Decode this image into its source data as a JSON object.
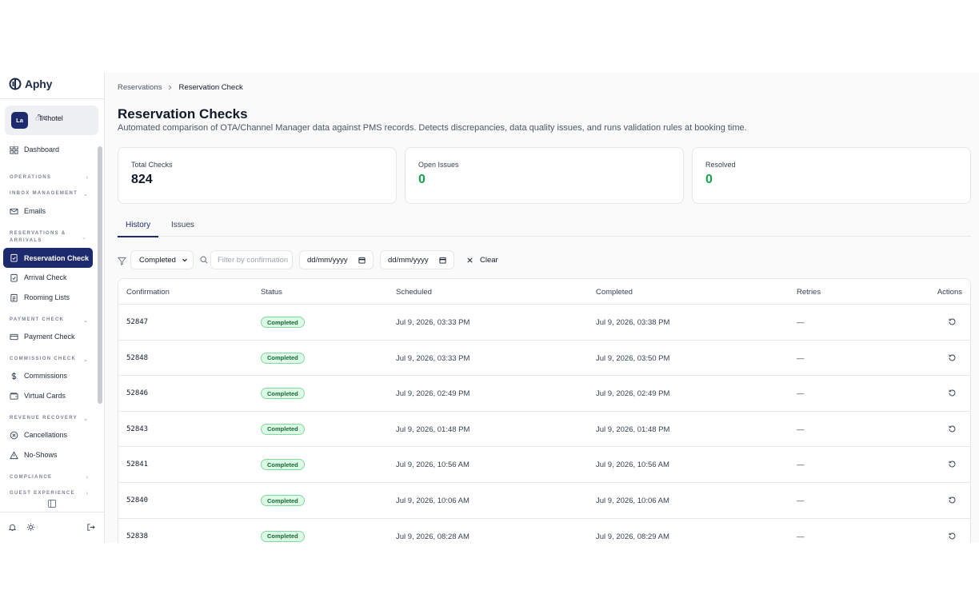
{
  "app": {
    "name": "Aphy"
  },
  "hotel": {
    "initials": "La",
    "name": "ीlधhotel"
  },
  "sidebar": {
    "dashboard": "Dashboard",
    "sections": {
      "operations": "OPERATIONS",
      "inbox": "INBOX MANAGEMENT",
      "reservations_line1": "RESERVATIONS &",
      "reservations_line2": "ARRIVALS",
      "payment": "PAYMENT CHECK",
      "commission": "COMMISSION CHECK",
      "revenue": "REVENUE RECOVERY",
      "compliance": "COMPLIANCE",
      "guest": "GUEST EXPERIENCE"
    },
    "items": {
      "emails": "Emails",
      "reservation_check": "Reservation Check",
      "arrival_check": "Arrival Check",
      "rooming_lists": "Rooming Lists",
      "payment_check": "Payment Check",
      "commissions": "Commissions",
      "virtual_cards": "Virtual Cards",
      "cancellations": "Cancellations",
      "no_shows": "No-Shows"
    }
  },
  "breadcrumb": {
    "parent": "Reservations",
    "current": "Reservation Check"
  },
  "page": {
    "title": "Reservation Checks",
    "subtitle": "Automated comparison of OTA/Channel Manager data against PMS records. Detects discrepancies, data quality issues, and runs validation rules at booking time."
  },
  "stats": {
    "total": {
      "label": "Total Checks",
      "value": "824"
    },
    "open": {
      "label": "Open Issues",
      "value": "0"
    },
    "resolved": {
      "label": "Resolved",
      "value": "0"
    }
  },
  "tabs": {
    "history": "History",
    "issues": "Issues"
  },
  "filters": {
    "status": "Completed",
    "search_placeholder": "Filter by confirmation",
    "date_from": "dd/mm/yyyy",
    "date_to": "dd/mm/yyyy",
    "clear": "Clear"
  },
  "table": {
    "headers": {
      "confirmation": "Confirmation",
      "status": "Status",
      "scheduled": "Scheduled",
      "completed": "Completed",
      "retries": "Retries",
      "actions": "Actions"
    },
    "rows": [
      {
        "conf": "52847",
        "status": "Completed",
        "scheduled": "Jul 9, 2026, 03:33 PM",
        "completed": "Jul 9, 2026, 03:38 PM",
        "retries": "—"
      },
      {
        "conf": "52848",
        "status": "Completed",
        "scheduled": "Jul 9, 2026, 03:33 PM",
        "completed": "Jul 9, 2026, 03:50 PM",
        "retries": "—"
      },
      {
        "conf": "52846",
        "status": "Completed",
        "scheduled": "Jul 9, 2026, 02:49 PM",
        "completed": "Jul 9, 2026, 02:49 PM",
        "retries": "—"
      },
      {
        "conf": "52843",
        "status": "Completed",
        "scheduled": "Jul 9, 2026, 01:48 PM",
        "completed": "Jul 9, 2026, 01:48 PM",
        "retries": "—"
      },
      {
        "conf": "52841",
        "status": "Completed",
        "scheduled": "Jul 9, 2026, 10:56 AM",
        "completed": "Jul 9, 2026, 10:56 AM",
        "retries": "—"
      },
      {
        "conf": "52840",
        "status": "Completed",
        "scheduled": "Jul 9, 2026, 10:06 AM",
        "completed": "Jul 9, 2026, 10:06 AM",
        "retries": "—"
      },
      {
        "conf": "52838",
        "status": "Completed",
        "scheduled": "Jul 9, 2026, 08:28 AM",
        "completed": "Jul 9, 2026, 08:29 AM",
        "retries": "—"
      }
    ]
  },
  "colors": {
    "primary": "#1e2a6e",
    "success": "#16a34a",
    "badge_bg": "#dcfce7"
  }
}
